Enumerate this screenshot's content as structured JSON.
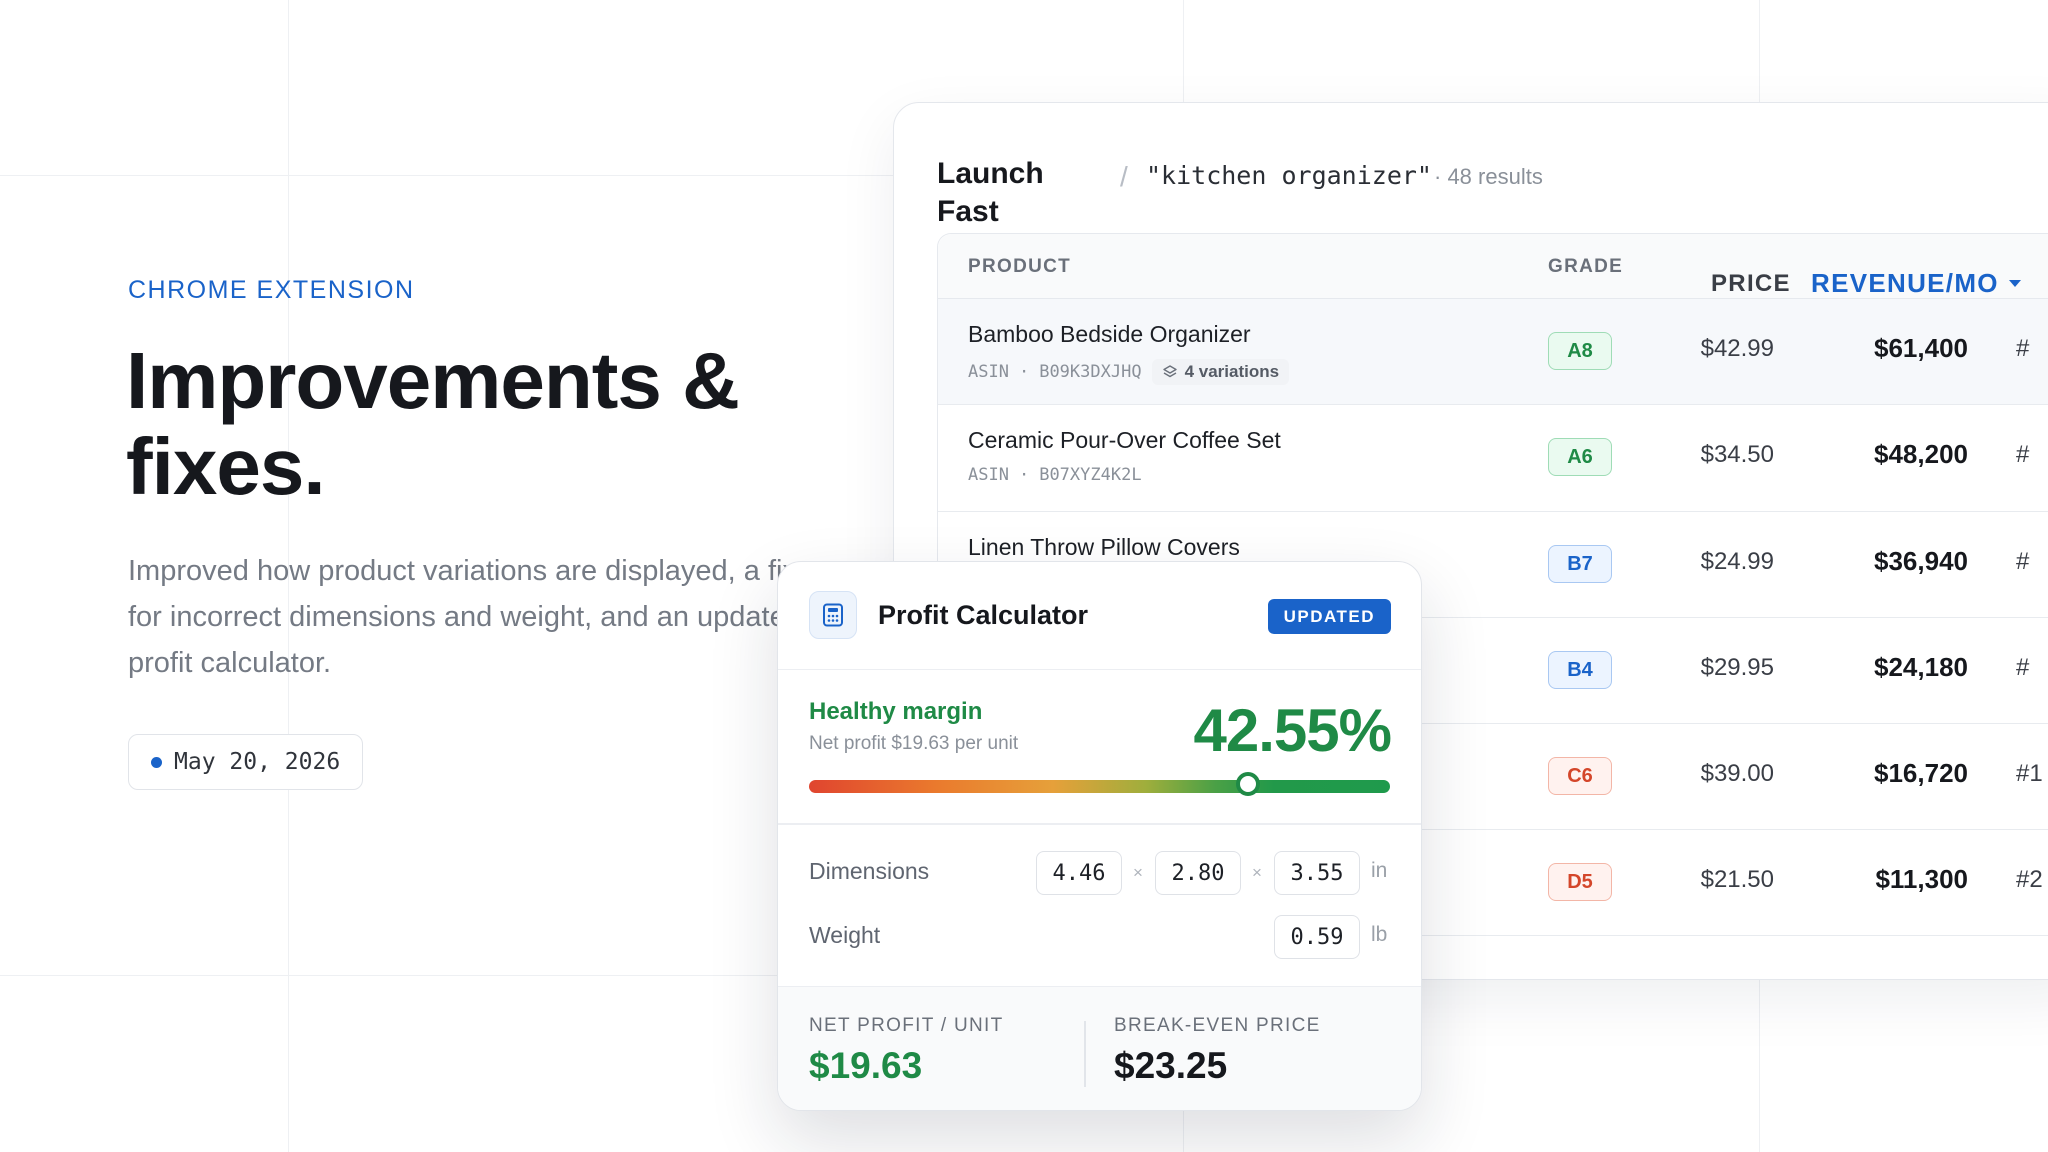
{
  "hero": {
    "eyebrow": "CHROME EXTENSION",
    "headline_line1": "Improvements &",
    "headline_line2": "fixes.",
    "description": "Improved how product variations are displayed, a fix for incorrect dimensions and weight, and an updated profit calculator.",
    "date": "May 20, 2026"
  },
  "results": {
    "brand_line1": "Launch",
    "brand_line2": "Fast",
    "separator": "/",
    "query": "\"kitchen organizer\"",
    "count": "· 48 results",
    "columns": {
      "product": "PRODUCT",
      "grade": "GRADE",
      "price": "PRICE",
      "revenue": "REVENUE/MO"
    },
    "rows": [
      {
        "name": "Bamboo Bedside Organizer",
        "asin_label": "ASIN",
        "asin": "B09K3DXJHQ",
        "variations": "4 variations",
        "grade": "A8",
        "grade_tier": "a",
        "price": "$42.99",
        "revenue": "$61,400",
        "rank": "#"
      },
      {
        "name": "Ceramic Pour-Over Coffee Set",
        "asin_label": "ASIN",
        "asin": "B07XYZ4K2L",
        "grade": "A6",
        "grade_tier": "a",
        "price": "$34.50",
        "revenue": "$48,200",
        "rank": "#"
      },
      {
        "name": "Linen Throw Pillow Covers",
        "grade": "B7",
        "grade_tier": "b",
        "price": "$24.99",
        "revenue": "$36,940",
        "rank": "#"
      },
      {
        "grade": "B4",
        "grade_tier": "b",
        "price": "$29.95",
        "revenue": "$24,180",
        "rank": "#"
      },
      {
        "grade": "C6",
        "grade_tier": "c",
        "price": "$39.00",
        "revenue": "$16,720",
        "rank": "#1"
      },
      {
        "grade": "D5",
        "grade_tier": "c",
        "price": "$21.50",
        "revenue": "$11,300",
        "rank": "#2"
      }
    ]
  },
  "calculator": {
    "title": "Profit Calculator",
    "badge": "UPDATED",
    "margin_label": "Healthy margin",
    "margin_sub": "Net profit $19.63 per unit",
    "margin_pct": "42.55%",
    "slider_fraction": 0.755,
    "dimensions_label": "Dimensions",
    "dimensions": [
      "4.46",
      "2.80",
      "3.55"
    ],
    "times": "×",
    "dimension_unit": "in",
    "weight_label": "Weight",
    "weight": "0.59",
    "weight_unit": "lb",
    "net_profit_label": "NET PROFIT / UNIT",
    "net_profit": "$19.63",
    "break_even_label": "BREAK-EVEN PRICE",
    "break_even": "$23.25"
  },
  "colors": {
    "accent": "#1a63c9",
    "success": "#1f8a46"
  }
}
